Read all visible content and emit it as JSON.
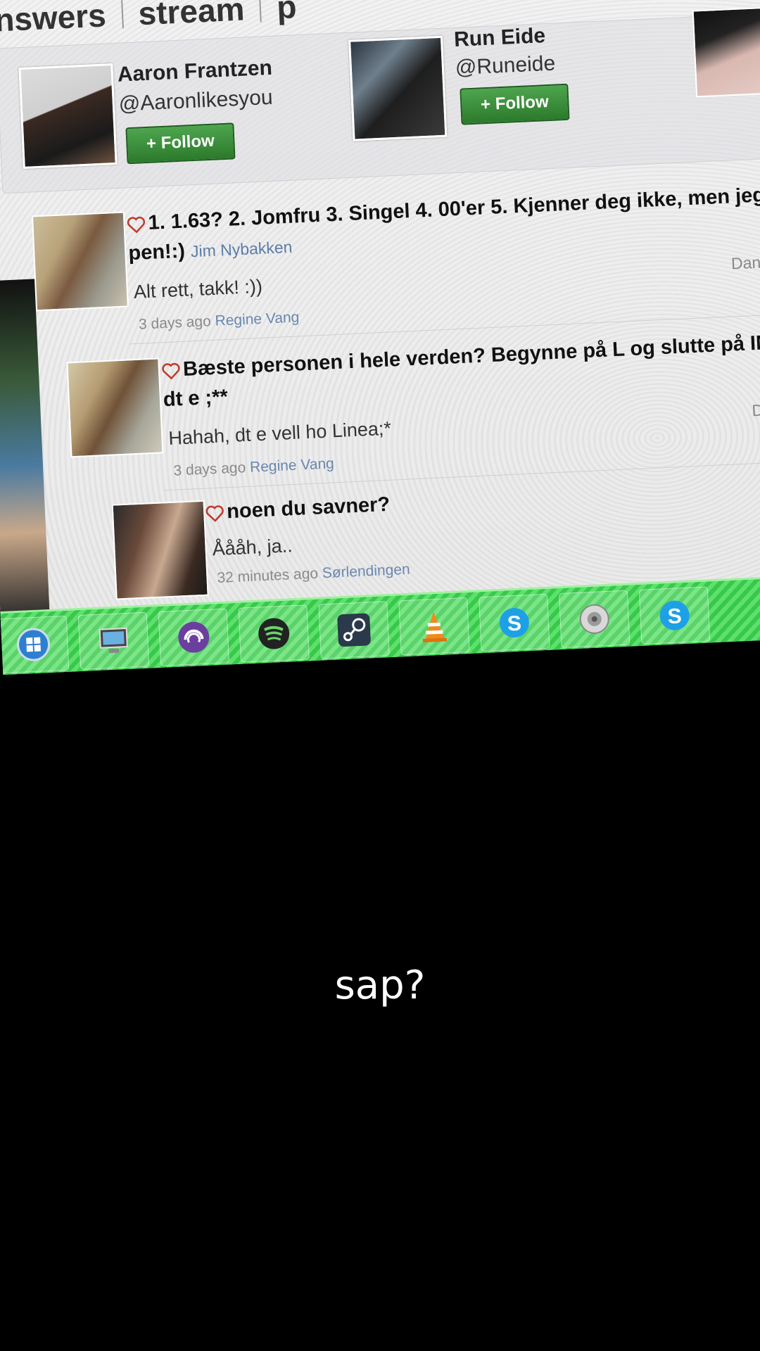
{
  "tabs": [
    "nswers",
    "stream",
    "p"
  ],
  "suggestions": [
    {
      "name": "Aaron Frantzen",
      "handle": "@Aaronlikesyou",
      "follow_label": "+ Follow"
    },
    {
      "name": "Run Eide",
      "handle": "@Runeide",
      "follow_label": "+ Follow"
    }
  ],
  "feed": [
    {
      "question_line1": "1. 1.63? 2. Jomfru 3. Singel 4. 00'er 5. Kjenner deg ikke, men jeg",
      "question_line2": "pen!:)",
      "asker": "Jim Nybakken",
      "answer": "Alt rett, takk! :))",
      "time": "3 days ago",
      "answerer": "Regine Vang",
      "right_name": "Danie"
    },
    {
      "question_line1": "Bæste personen i hele verden? Begynne på L og slutte på INE",
      "question_line2": "dt e ;**",
      "asker": "",
      "answer": "Hahah, dt e vell ho Linea;*",
      "time": "3 days ago",
      "answerer": "Regine Vang",
      "right_name": "Danie"
    },
    {
      "question_line1": "noen du savner?",
      "question_line2": "",
      "asker": "",
      "answer": "Åååh, ja..",
      "time": "32 minutes ago",
      "answerer": "Sørlendingen",
      "right_name": ""
    }
  ],
  "taskbar": [
    "start-orb-icon",
    "computer-icon",
    "bittorrent-icon",
    "spotify-icon",
    "steam-icon",
    "vlc-icon",
    "skype-icon",
    "speaker-icon",
    "skype-icon"
  ],
  "caption": "sap?",
  "colors": {
    "follow_green": "#2c7a2c",
    "taskbar_green": "#37c94a",
    "link_blue": "#5b7da8"
  }
}
